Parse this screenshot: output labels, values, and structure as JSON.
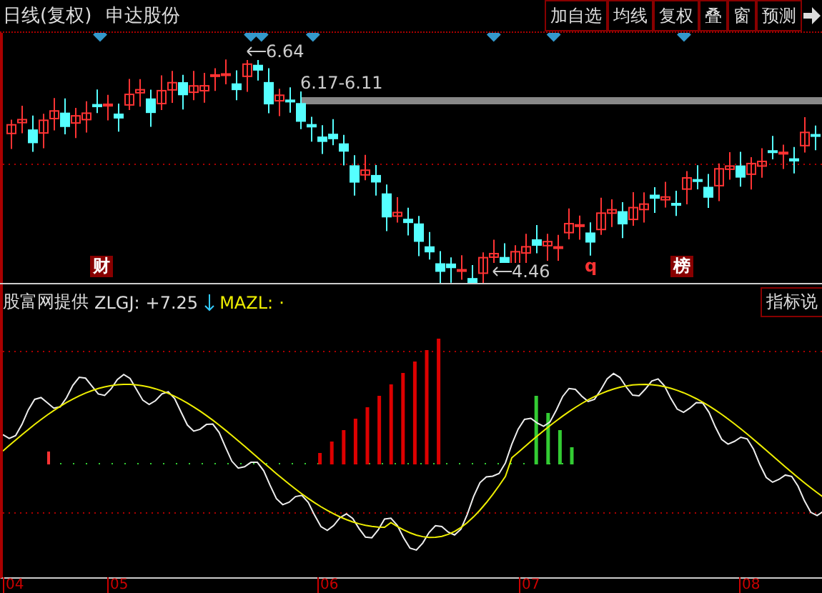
{
  "header": {
    "period": "日线(复权)",
    "stock": "申达股份",
    "buttons": [
      "加自选",
      "均线",
      "复权",
      "叠",
      "窗",
      "预测"
    ]
  },
  "price_labels": [
    {
      "text": "6.64",
      "kind": "arrow"
    },
    {
      "text": "6.17-6.11",
      "kind": "range"
    },
    {
      "text": "4.46",
      "kind": "arrow"
    }
  ],
  "markers": [
    {
      "text": "财",
      "kind": "box"
    },
    {
      "text": "q",
      "kind": "plain"
    },
    {
      "text": "榜",
      "kind": "box"
    }
  ],
  "indicator": {
    "source": "股富网提供",
    "zlgj_label": "ZLGJ:",
    "zlgj_value": "+7.25",
    "trend_down": true,
    "mazl_label": "MAZL:",
    "mazl_value": "·",
    "button": "指标说"
  },
  "axis": [
    "04",
    "05",
    "06",
    "07",
    "08"
  ]
}
